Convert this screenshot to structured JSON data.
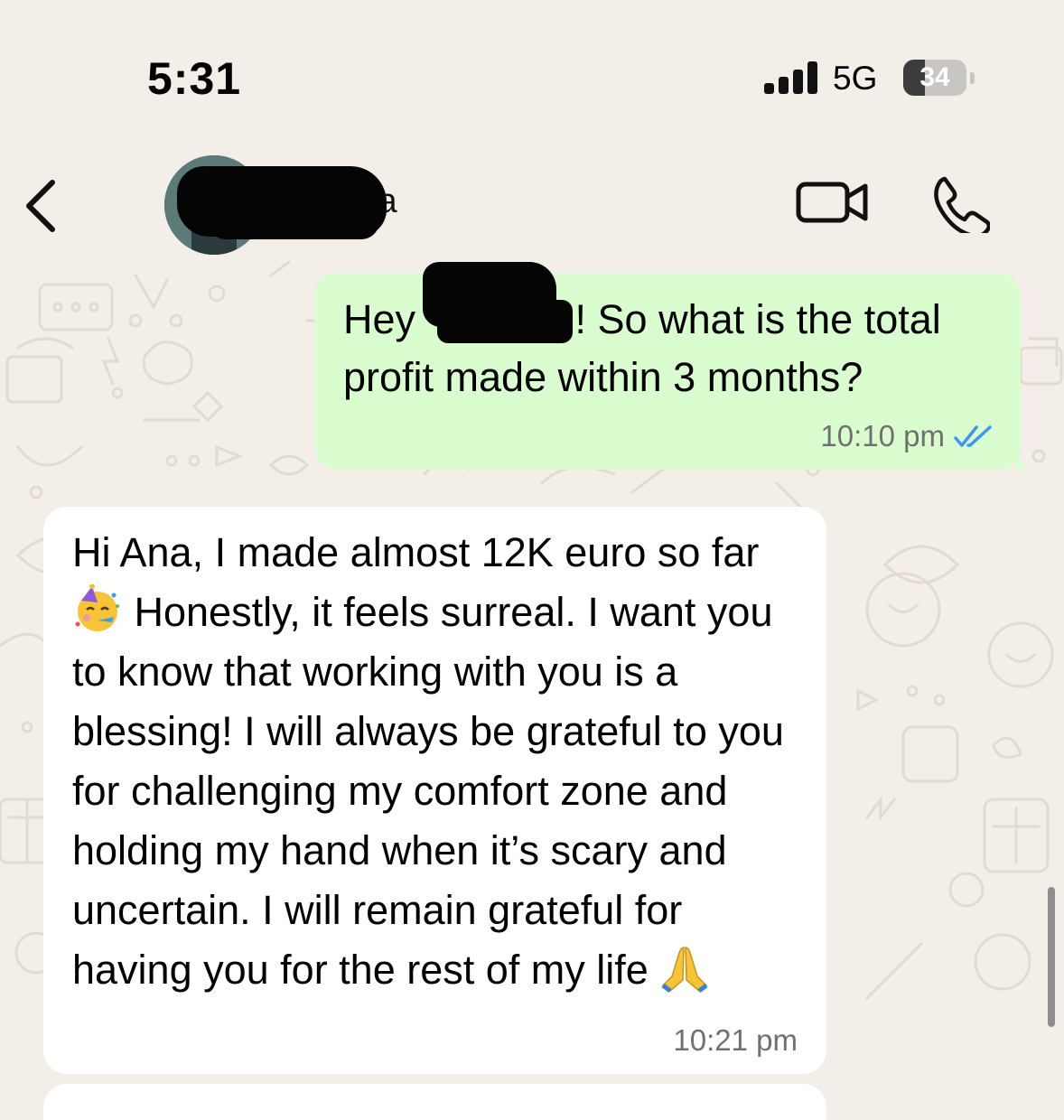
{
  "status_bar": {
    "time": "5:31",
    "network": "5G",
    "battery_percent": "34",
    "battery_level": 0.34
  },
  "header": {
    "back_icon": "chevron-left-icon",
    "contact_name_visible": "ia",
    "video_icon": "video-camera-icon",
    "call_icon": "phone-icon"
  },
  "messages": [
    {
      "direction": "outgoing",
      "text_before": "Hey ",
      "text_after": "! So what is the total profit made within 3 months?",
      "time": "10:10 pm",
      "status_icon": "double-check-icon",
      "status_color": "#3b97f0"
    },
    {
      "direction": "incoming",
      "text_part1": "Hi Ana, I made almost 12K euro so far ",
      "emoji1": "partying-face-emoji",
      "text_part2": " Honestly, it feels surreal. I want you to know that working with you is a blessing! I will always be grateful to you for challenging my comfort zone and holding my hand when it’s scary and uncertain. I will remain grateful for having you for the rest of my life ",
      "emoji2": "folded-hands-emoji",
      "time": "10:21 pm"
    }
  ],
  "colors": {
    "background": "#f3efe8",
    "outgoing_bubble": "#dafdcf",
    "incoming_bubble": "#ffffff",
    "accent_ticks": "#3b97f0"
  }
}
